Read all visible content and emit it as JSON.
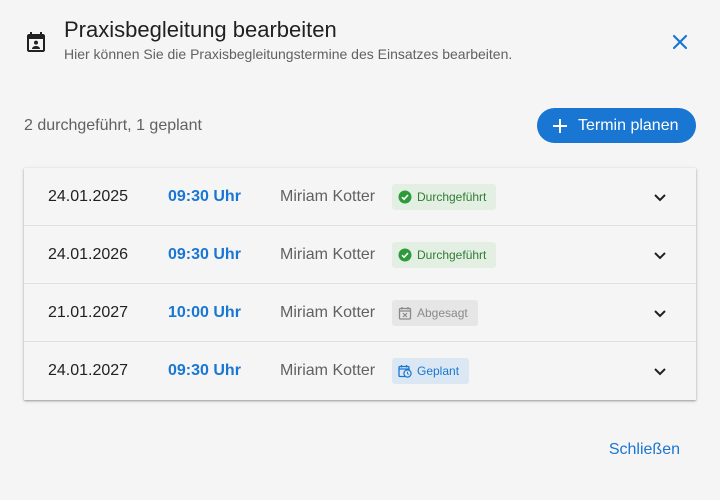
{
  "header": {
    "title": "Praxisbegleitung bearbeiten",
    "subtitle": "Hier können Sie die Praxisbegleitungstermine des Einsatzes bearbeiten."
  },
  "summary": "2 durchgeführt, 1 geplant",
  "plan_button_label": "Termin planen",
  "appointments": [
    {
      "date": "24.01.2025",
      "time": "09:30 Uhr",
      "name": "Miriam Kotter",
      "status": "Durchgeführt",
      "status_type": "done"
    },
    {
      "date": "24.01.2026",
      "time": "09:30 Uhr",
      "name": "Miriam Kotter",
      "status": "Durchgeführt",
      "status_type": "done"
    },
    {
      "date": "21.01.2027",
      "time": "10:00 Uhr",
      "name": "Miriam Kotter",
      "status": "Abgesagt",
      "status_type": "cancelled"
    },
    {
      "date": "24.01.2027",
      "time": "09:30 Uhr",
      "name": "Miriam Kotter",
      "status": "Geplant",
      "status_type": "planned"
    }
  ],
  "footer": {
    "close_label": "Schließen"
  },
  "colors": {
    "primary": "#1976d2",
    "done": "#2e7d32",
    "cancelled": "#8a8a8a",
    "background": "#f5f5f5"
  }
}
